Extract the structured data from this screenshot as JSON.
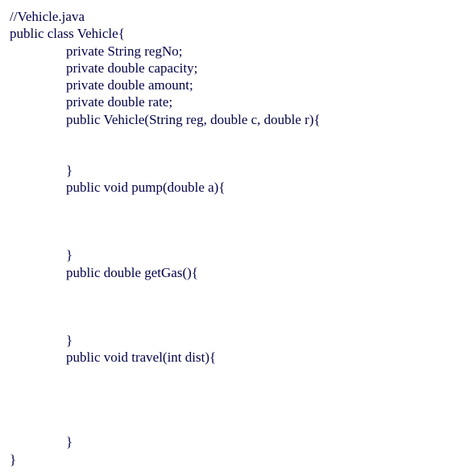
{
  "code": {
    "l1": "//Vehicle.java",
    "l2": "public class Vehicle{",
    "l3": "private String regNo;",
    "l4": "private double capacity;",
    "l5": "private double amount;",
    "l6": "private double rate;",
    "l7": "public Vehicle(String reg, double c, double r){",
    "l8": "}",
    "l9": "public void pump(double a){",
    "l10": "}",
    "l11": "public double getGas(){",
    "l12": "}",
    "l13": "public void travel(int dist){",
    "l14": "}",
    "l15": "}"
  }
}
